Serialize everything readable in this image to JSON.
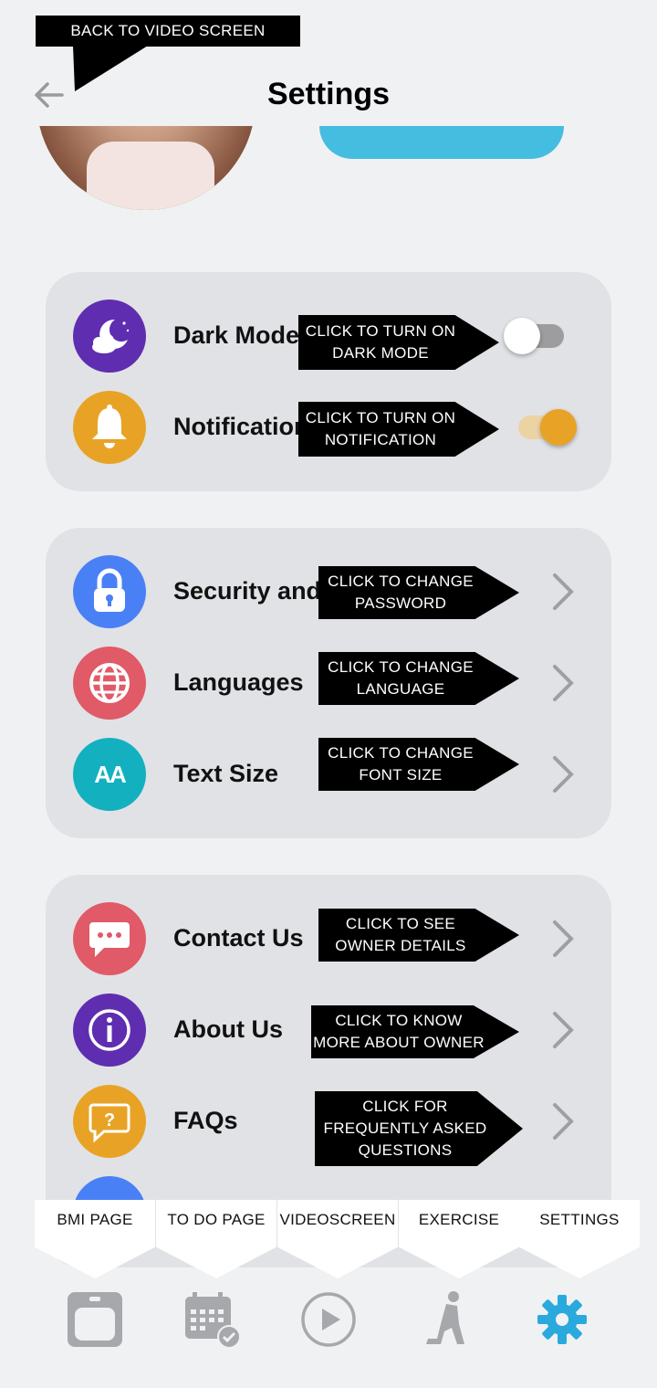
{
  "header": {
    "title": "Settings",
    "back_callout": "BACK TO VIDEO SCREEN"
  },
  "toggles_card": {
    "rows": [
      {
        "label": "Dark Mode",
        "icon": "moon-clouds-icon",
        "icon_color": "#5f2db0",
        "callout_line1": "CLICK TO TURN ON",
        "callout_line2": "DARK MODE",
        "enabled": false
      },
      {
        "label": "Notification",
        "icon": "bell-icon",
        "icon_color": "#e8a326",
        "callout_line1": "CLICK TO TURN ON",
        "callout_line2": "NOTIFICATION",
        "enabled": true
      }
    ]
  },
  "prefs_card": {
    "rows": [
      {
        "label": "Security and",
        "icon": "lock-icon",
        "icon_color": "#4a80f5",
        "callout_line1": "CLICK TO CHANGE",
        "callout_line2": "PASSWORD"
      },
      {
        "label": "Languages",
        "icon": "globe-icon",
        "icon_color": "#e05a68",
        "callout_line1": "CLICK TO CHANGE",
        "callout_line2": "LANGUAGE"
      },
      {
        "label": "Text Size",
        "icon": "text-size-icon",
        "icon_color": "#13b0c0",
        "icon_text": "AA",
        "callout_line1": "CLICK TO CHANGE",
        "callout_line2": "FONT SIZE"
      }
    ]
  },
  "info_card": {
    "rows": [
      {
        "label": "Contact Us",
        "icon": "chat-icon",
        "icon_color": "#e05a68",
        "callout_line1": "CLICK TO SEE",
        "callout_line2": "OWNER DETAILS"
      },
      {
        "label": "About Us",
        "icon": "info-icon",
        "icon_color": "#5f2db0",
        "callout_line1": "CLICK TO KNOW",
        "callout_line2": "MORE ABOUT OWNER"
      },
      {
        "label": "FAQs",
        "icon": "question-icon",
        "icon_color": "#e8a326",
        "callout_line1": "CLICK FOR",
        "callout_line2": "FREQUENTLY ASKED",
        "callout_line3": "QUESTIONS"
      }
    ]
  },
  "bottom_nav": {
    "tabs": [
      {
        "label": "BMI PAGE",
        "icon": "scale-icon"
      },
      {
        "label": "TO DO PAGE",
        "icon": "calendar-check-icon"
      },
      {
        "label": "VIDEOSCREEN",
        "icon": "play-icon"
      },
      {
        "label": "EXERCISE",
        "icon": "exercise-icon"
      },
      {
        "label": "SETTINGS",
        "icon": "gear-icon",
        "active_color": "#2aa9dd"
      }
    ]
  }
}
